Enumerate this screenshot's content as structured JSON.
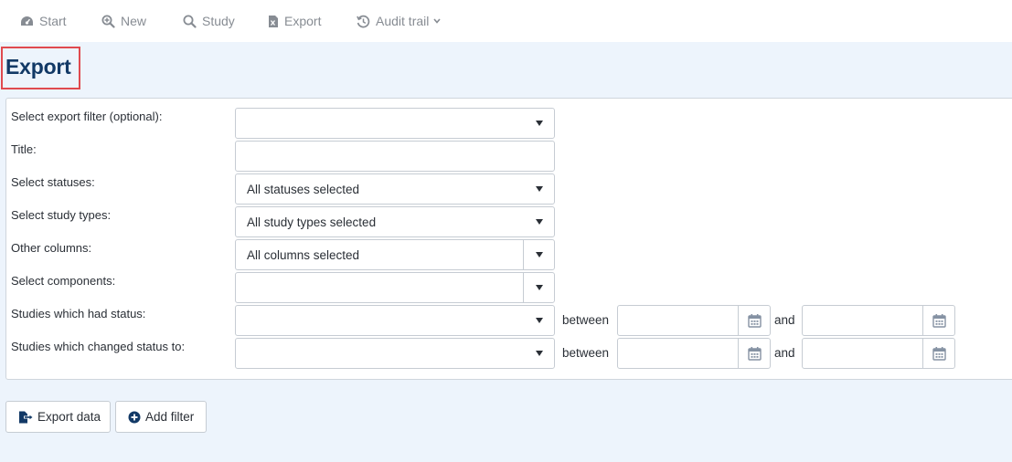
{
  "nav": {
    "start": "Start",
    "new": "New",
    "study": "Study",
    "export": "Export",
    "audit_trail": "Audit trail"
  },
  "page": {
    "title": "Export"
  },
  "form": {
    "export_filter": {
      "label": "Select export filter (optional):",
      "value": ""
    },
    "title": {
      "label": "Title:",
      "value": ""
    },
    "statuses": {
      "label": "Select statuses:",
      "value": "All statuses selected"
    },
    "study_types": {
      "label": "Select study types:",
      "value": "All study types selected"
    },
    "other_columns": {
      "label": "Other columns:",
      "value": "All columns selected"
    },
    "components": {
      "label": "Select components:",
      "value": ""
    },
    "had_status": {
      "label": "Studies which had status:",
      "value": "",
      "between": "between",
      "and": "and"
    },
    "changed_status": {
      "label": "Studies which changed status to:",
      "value": "",
      "between": "between",
      "and": "and"
    }
  },
  "actions": {
    "export_data": "Export data",
    "add_filter": "Add filter"
  },
  "icons": {
    "start": "dashboard-icon",
    "new": "zoom-in-icon",
    "study": "search-icon",
    "export": "excel-file-icon",
    "audit_trail": "history-icon",
    "calendar": "calendar-icon",
    "export_data": "file-export-icon",
    "add_filter": "plus-circle-icon"
  },
  "colors": {
    "nav_text": "#878c93",
    "title": "#123966",
    "highlight_border": "#e04a4f",
    "page_bg": "#edf4fc"
  }
}
